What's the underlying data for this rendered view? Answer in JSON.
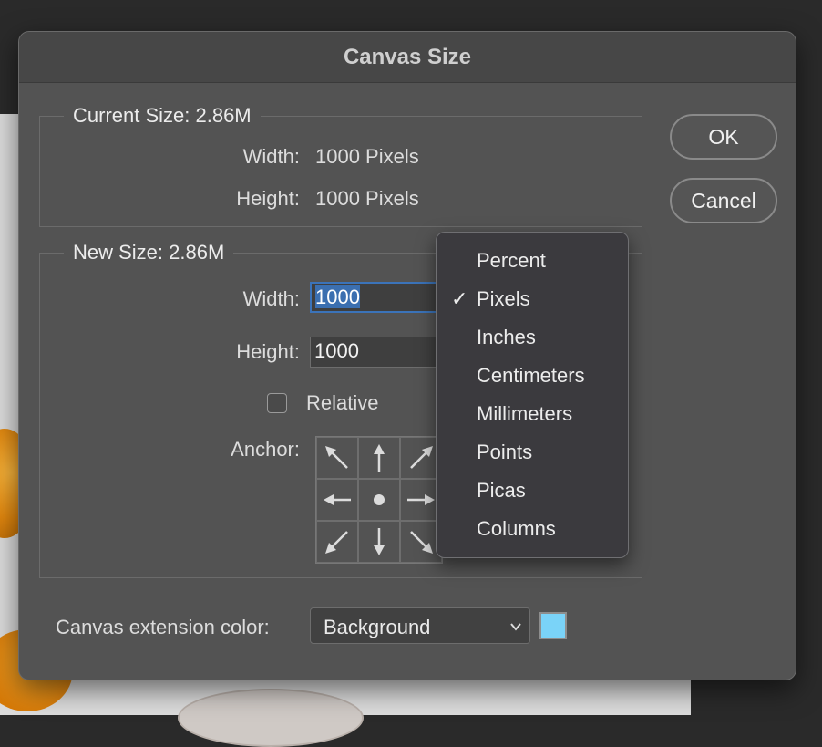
{
  "dialog": {
    "title": "Canvas Size",
    "buttons": {
      "ok": "OK",
      "cancel": "Cancel"
    }
  },
  "current_size": {
    "legend": "Current Size: 2.86M",
    "width_label": "Width:",
    "width_value": "1000 Pixels",
    "height_label": "Height:",
    "height_value": "1000 Pixels"
  },
  "new_size": {
    "legend": "New Size: 2.86M",
    "width_label": "Width:",
    "width_value": "1000",
    "height_label": "Height:",
    "height_value": "1000",
    "relative_label": "Relative",
    "relative_checked": false,
    "anchor_label": "Anchor:"
  },
  "units_menu": {
    "selected": "Pixels",
    "items": [
      "Percent",
      "Pixels",
      "Inches",
      "Centimeters",
      "Millimeters",
      "Points",
      "Picas",
      "Columns"
    ],
    "check_glyph": "✓"
  },
  "extension": {
    "label": "Canvas extension color:",
    "value": "Background",
    "swatch_color": "#7ad3f8"
  },
  "colors": {
    "selection": "#3b6fb0",
    "dialog_bg": "#535353"
  }
}
